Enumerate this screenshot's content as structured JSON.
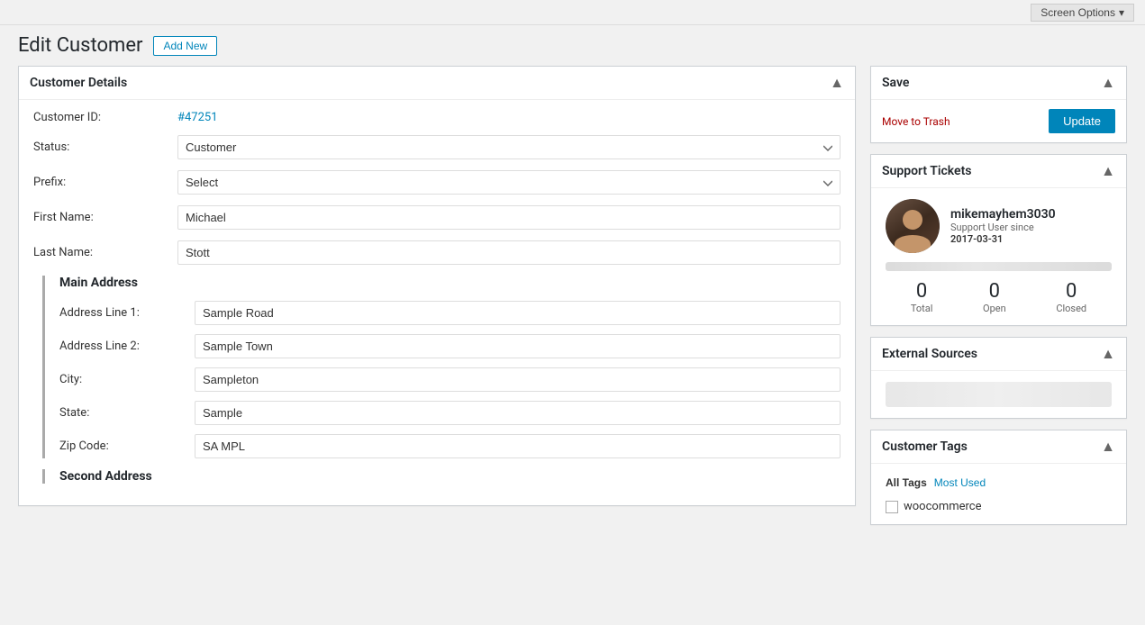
{
  "topbar": {
    "screen_options_label": "Screen Options",
    "chevron": "▾"
  },
  "header": {
    "title": "Edit Customer",
    "add_new_label": "Add New"
  },
  "customer_details": {
    "section_title": "Customer Details",
    "customer_id_label": "Customer ID:",
    "customer_id_value": "#47251",
    "status_label": "Status:",
    "status_value": "Customer",
    "prefix_label": "Prefix:",
    "prefix_value": "Select",
    "first_name_label": "First Name:",
    "first_name_value": "Michael",
    "last_name_label": "Last Name:",
    "last_name_value": "Stott",
    "main_address_title": "Main Address",
    "address1_label": "Address Line 1:",
    "address1_value": "Sample Road",
    "address2_label": "Address Line 2:",
    "address2_value": "Sample Town",
    "city_label": "City:",
    "city_value": "Sampleton",
    "state_label": "State:",
    "state_value": "Sample",
    "zip_label": "Zip Code:",
    "zip_value": "SA MPL",
    "second_address_title": "Second Address"
  },
  "save_box": {
    "title": "Save",
    "move_to_trash": "Move to Trash",
    "update_label": "Update"
  },
  "support_tickets": {
    "title": "Support Tickets",
    "username": "mikemayhem3030",
    "since_label": "Support User since",
    "since_date": "2017-03-31",
    "total_label": "Total",
    "total_value": "0",
    "open_label": "Open",
    "open_value": "0",
    "closed_label": "Closed",
    "closed_value": "0"
  },
  "external_sources": {
    "title": "External Sources"
  },
  "customer_tags": {
    "title": "Customer Tags",
    "tab_all": "All Tags",
    "tab_most_used": "Most Used",
    "tags": [
      {
        "label": "woocommerce",
        "checked": false
      }
    ]
  }
}
